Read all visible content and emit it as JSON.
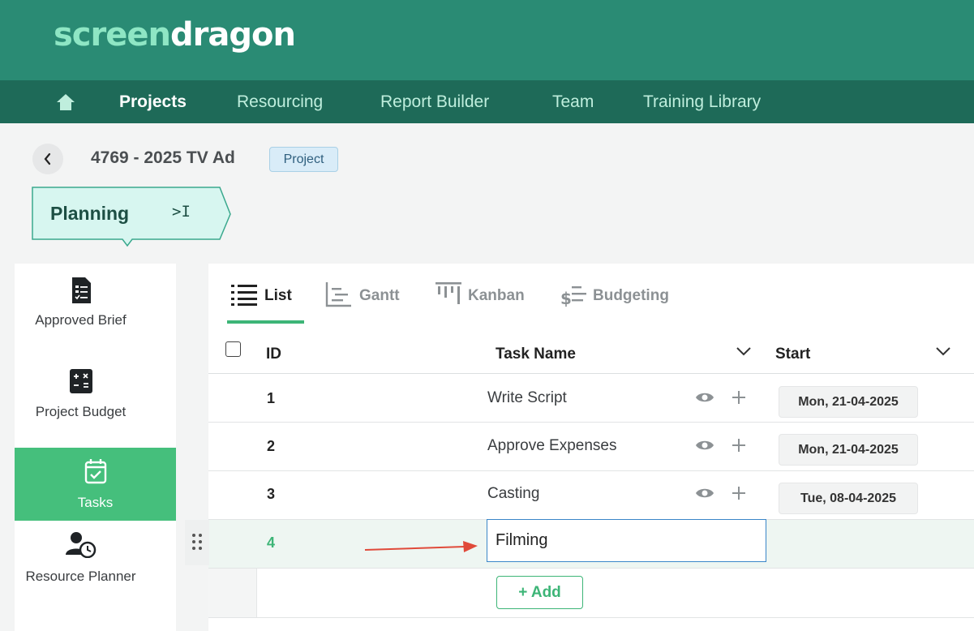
{
  "brand": {
    "logo_part1": "screen",
    "logo_part2": "dragon"
  },
  "nav": {
    "home_icon": "home-icon",
    "items": [
      {
        "label": "Projects",
        "active": true
      },
      {
        "label": "Resourcing",
        "active": false
      },
      {
        "label": "Report Builder",
        "active": false
      },
      {
        "label": "Team",
        "active": false
      },
      {
        "label": "Training Library",
        "active": false
      }
    ]
  },
  "project": {
    "title": "4769 - 2025 TV Ad",
    "badge": "Project",
    "stage": "Planning",
    "collapse_glyph": ">I"
  },
  "sidebar": {
    "items": [
      {
        "label": "Approved Brief",
        "icon": "brief-document-icon",
        "active": false
      },
      {
        "label": "Project Budget",
        "icon": "calculator-icon",
        "active": false
      },
      {
        "label": "Tasks",
        "icon": "calendar-check-icon",
        "active": true
      },
      {
        "label": "Resource Planner",
        "icon": "user-clock-icon",
        "active": false
      }
    ]
  },
  "views": {
    "tabs": [
      {
        "label": "List",
        "icon": "list-icon",
        "active": true
      },
      {
        "label": "Gantt",
        "icon": "gantt-icon",
        "active": false
      },
      {
        "label": "Kanban",
        "icon": "kanban-icon",
        "active": false
      },
      {
        "label": "Budgeting",
        "icon": "budget-icon",
        "active": false
      }
    ]
  },
  "table": {
    "columns": {
      "id": "ID",
      "name": "Task Name",
      "start": "Start"
    },
    "rows": [
      {
        "id": "1",
        "name": "Write Script",
        "start": "Mon, 21-04-2025"
      },
      {
        "id": "2",
        "name": "Approve Expenses",
        "start": "Mon, 21-04-2025"
      },
      {
        "id": "3",
        "name": "Casting",
        "start": "Tue, 08-04-2025"
      }
    ],
    "new_row": {
      "id": "4",
      "name_value": "Filming"
    },
    "add_label": "+ Add"
  },
  "colors": {
    "brand": "#2a8b74",
    "nav": "#1e6a58",
    "accent": "#45bf7c",
    "input_border": "#3a86c8",
    "arrow": "#e04a3a"
  }
}
